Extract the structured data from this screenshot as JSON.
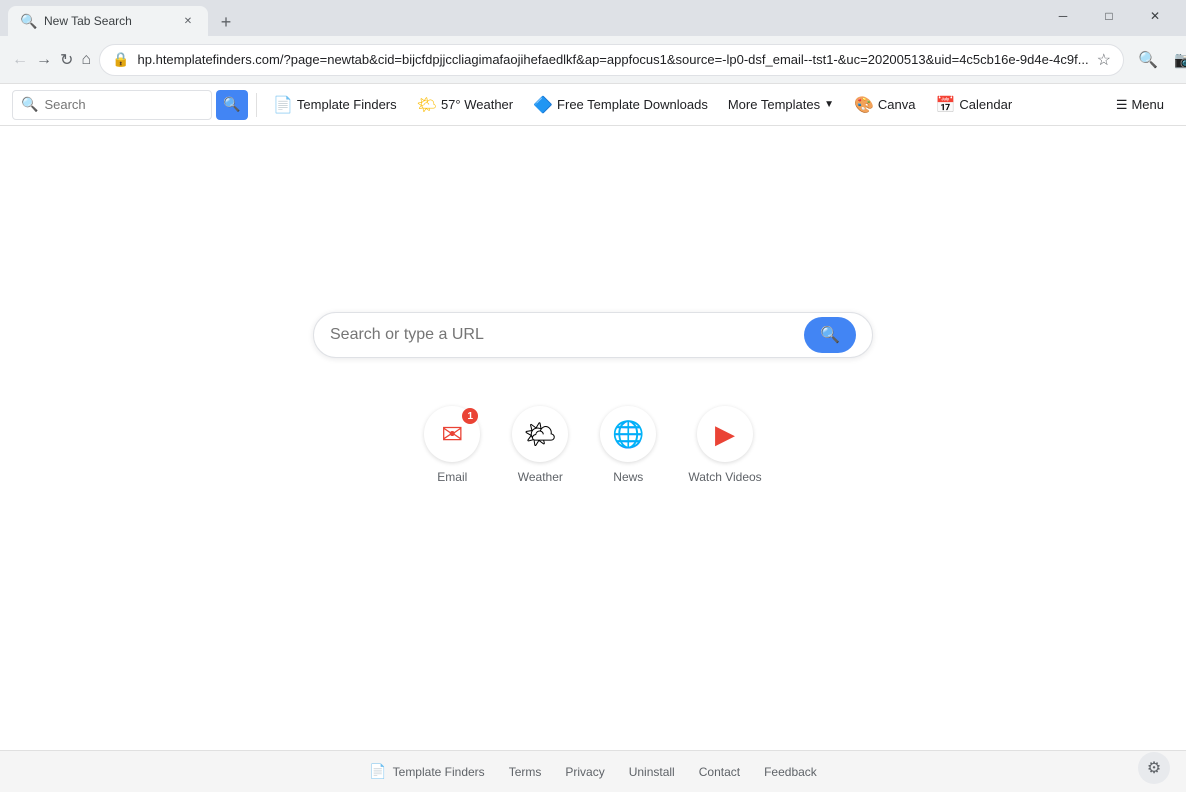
{
  "browser": {
    "tab": {
      "title": "New Tab Search",
      "favicon": "🔍"
    },
    "address_bar": {
      "url": "hp.htemplatefinders.com/?page=newtab&cid=bijcfdpjjccliagimafaojihefaedlkf&ap=appfocus1&source=-lp0-dsf_email--tst1-&uc=20200513&uid=4c5cb16e-9d4e-4c9f...",
      "short_url": "hp.htemplatefinders.com/?page=newtab&cid=bijcfdpjjccliagimafaojihefaedlkf&ap=appfocus1&source=-lp0-dsf_email--tst1-&uc=20200513&uid=4c5cb16e-9d4e-4c9f..."
    }
  },
  "toolbar": {
    "search_placeholder": "Search",
    "template_finders_label": "Template Finders",
    "weather_label": "57° Weather",
    "free_templates_label": "Free Template Downloads",
    "more_templates_label": "More Templates",
    "canva_label": "Canva",
    "calendar_label": "Calendar",
    "menu_label": "Menu"
  },
  "main": {
    "search_placeholder": "Search or type a URL"
  },
  "quick_access": [
    {
      "label": "Email",
      "icon": "✉",
      "notification": "1"
    },
    {
      "label": "Weather",
      "icon": "🌤",
      "notification": null
    },
    {
      "label": "News",
      "icon": "🌐",
      "notification": null
    },
    {
      "label": "Watch Videos",
      "icon": "▶",
      "notification": null
    }
  ],
  "footer": {
    "template_finders_label": "Template Finders",
    "terms_label": "Terms",
    "privacy_label": "Privacy",
    "uninstall_label": "Uninstall",
    "contact_label": "Contact",
    "feedback_label": "Feedback"
  },
  "window_controls": {
    "minimize": "─",
    "maximize": "□",
    "close": "✕"
  }
}
